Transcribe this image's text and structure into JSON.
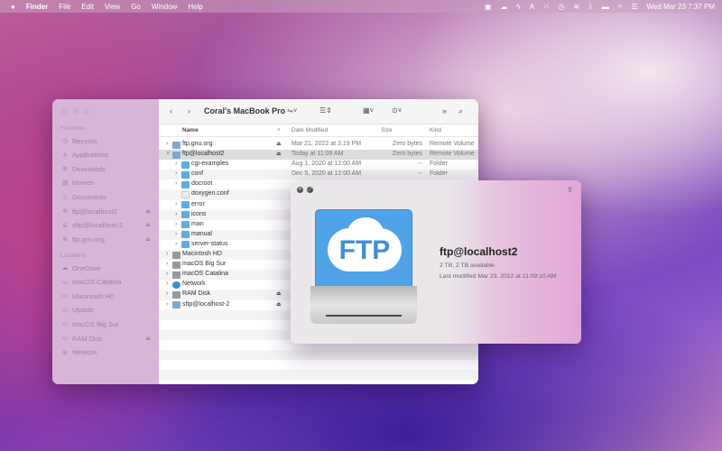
{
  "menubar": {
    "apple": "",
    "app": "Finder",
    "items": [
      "File",
      "Edit",
      "View",
      "Go",
      "Window",
      "Help"
    ],
    "datetime": "Wed Mar 23  7:37 PM"
  },
  "finder": {
    "title": "Coral's MacBook Pro",
    "sidebar": {
      "favorites_label": "Favorites",
      "favorites": [
        {
          "label": "Recents",
          "icon": "clock"
        },
        {
          "label": "Applications",
          "icon": "apps"
        },
        {
          "label": "Downloads",
          "icon": "download"
        },
        {
          "label": "Movies",
          "icon": "film"
        },
        {
          "label": "Documents",
          "icon": "doc"
        },
        {
          "label": "ftp@localhost2",
          "icon": "network-volume",
          "eject": true
        },
        {
          "label": "sftp@localhost-2",
          "icon": "network-volume",
          "eject": true
        },
        {
          "label": "ftp.gnu.org",
          "icon": "network-volume",
          "eject": true
        }
      ],
      "locations_label": "Locations",
      "locations": [
        {
          "label": "OneDrive",
          "icon": "cloud"
        },
        {
          "label": "macOS Catalina",
          "icon": "disk"
        },
        {
          "label": "Macintosh HD",
          "icon": "disk"
        },
        {
          "label": "Update",
          "icon": "disk"
        },
        {
          "label": "macOS Big Sur",
          "icon": "disk"
        },
        {
          "label": "RAM Disk",
          "icon": "disk",
          "eject": true
        },
        {
          "label": "Network",
          "icon": "globe"
        }
      ]
    },
    "columns": {
      "name": "Name",
      "date": "Date Modified",
      "size": "Size",
      "kind": "Kind"
    },
    "rows": [
      {
        "name": "ftp.gnu.org",
        "level": 0,
        "icon": "vol",
        "eject": true,
        "date": "Mar 21, 2022 at 3:19 PM",
        "size": "Zero bytes",
        "kind": "Remote Volume",
        "disclosure": "closed"
      },
      {
        "name": "ftp@localhost2",
        "level": 0,
        "icon": "vol",
        "eject": true,
        "date": "Today at 11:09 AM",
        "size": "Zero bytes",
        "kind": "Remote Volume",
        "disclosure": "open",
        "selected": true
      },
      {
        "name": "cgi-examples",
        "level": 1,
        "icon": "folder",
        "date": "Aug 1, 2020 at 12:00 AM",
        "size": "--",
        "kind": "Folder",
        "disclosure": "closed"
      },
      {
        "name": "conf",
        "level": 1,
        "icon": "folder",
        "date": "Dec 5, 2020 at 12:00 AM",
        "size": "--",
        "kind": "Folder",
        "disclosure": "closed"
      },
      {
        "name": "docroot",
        "level": 1,
        "icon": "folder",
        "disclosure": "closed"
      },
      {
        "name": "doxygen.conf",
        "level": 1,
        "icon": "file"
      },
      {
        "name": "error",
        "level": 1,
        "icon": "folder",
        "disclosure": "closed"
      },
      {
        "name": "icons",
        "level": 1,
        "icon": "folder",
        "disclosure": "closed"
      },
      {
        "name": "man",
        "level": 1,
        "icon": "folder",
        "disclosure": "closed"
      },
      {
        "name": "manual",
        "level": 1,
        "icon": "folder",
        "disclosure": "closed"
      },
      {
        "name": "server-status",
        "level": 1,
        "icon": "folder",
        "disclosure": "closed"
      },
      {
        "name": "Macintosh HD",
        "level": 0,
        "icon": "disk",
        "disclosure": "closed"
      },
      {
        "name": "macOS Big Sur",
        "level": 0,
        "icon": "disk",
        "disclosure": "closed"
      },
      {
        "name": "macOS Catalina",
        "level": 0,
        "icon": "disk",
        "disclosure": "closed"
      },
      {
        "name": "Network",
        "level": 0,
        "icon": "net",
        "disclosure": "closed"
      },
      {
        "name": "RAM Disk",
        "level": 0,
        "icon": "disk",
        "eject": true,
        "disclosure": "closed"
      },
      {
        "name": "sftp@localhost-2",
        "level": 0,
        "icon": "vol",
        "eject": true,
        "disclosure": "closed"
      }
    ]
  },
  "quicklook": {
    "icon_text": "FTP",
    "name": "ftp@localhost2",
    "capacity": "2 TB, 2 TB available",
    "modified": "Last modified Mar 23, 2022 at 11:09:10 AM"
  }
}
